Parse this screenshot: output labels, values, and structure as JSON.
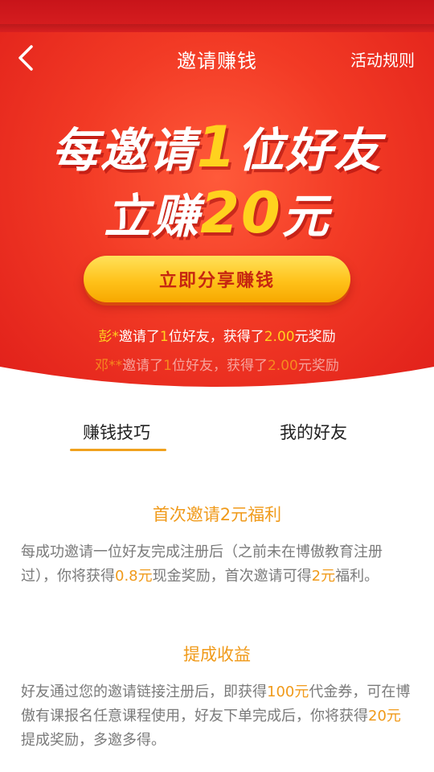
{
  "nav": {
    "title": "邀请赚钱",
    "rules_label": "活动规则"
  },
  "hero": {
    "headline_1_pre": "每邀请",
    "headline_1_num": "1",
    "headline_1_post": "位好友",
    "headline_2_pre": "立赚",
    "headline_2_num": "20",
    "headline_2_post": "元",
    "cta_label": "立即分享赚钱",
    "marquee": [
      {
        "user": "彭*",
        "t1": "邀请了",
        "n1": "1",
        "t2": "位好友，获得了",
        "n2": "2.00",
        "t3": "元奖励"
      },
      {
        "user": "邓**",
        "t1": "邀请了",
        "n1": "1",
        "t2": "位好友，获得了",
        "n2": "2.00",
        "t3": "元奖励"
      }
    ]
  },
  "tabs": {
    "tips": "赚钱技巧",
    "friends": "我的好友"
  },
  "sections": [
    {
      "title": "首次邀请2元福利",
      "p_a": "每成功邀请一位好友完成注册后（之前未在博傲教育注册过），你将获得",
      "p_h1": "0.8元",
      "p_b": "现金奖励，首次邀请可得",
      "p_h2": "2元",
      "p_c": "福利。"
    },
    {
      "title": "提成收益",
      "p_a": "好友通过您的邀请链接注册后，即获得",
      "p_h1": "100元",
      "p_b": "代金券，可在博傲有课报名任意课程使用，好友下单完成后，你将获得",
      "p_h2": "20元",
      "p_c": "提成奖励，多邀多得。"
    }
  ],
  "colors": {
    "hero_red": "#f23a25",
    "accent_yellow": "#ffd21e",
    "accent_orange": "#f09a1a"
  }
}
